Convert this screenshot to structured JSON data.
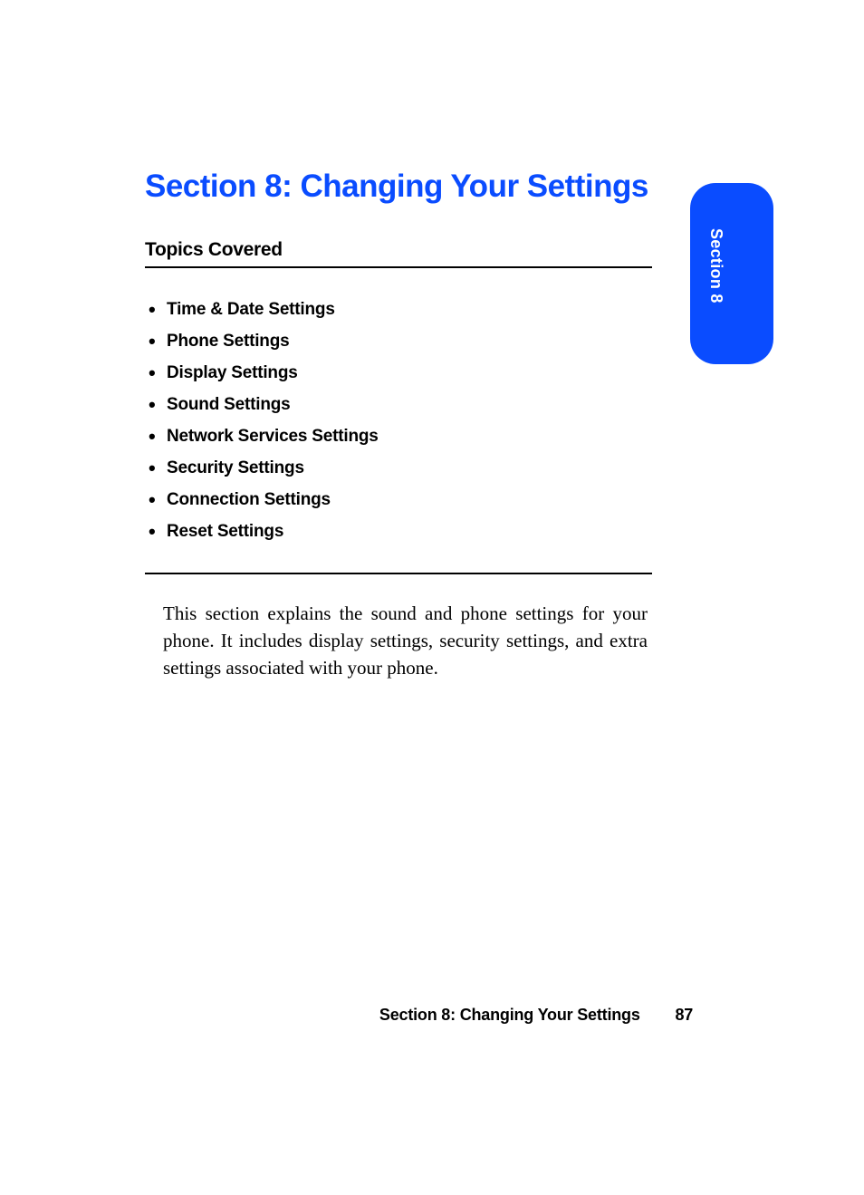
{
  "title": "Section 8: Changing Your Settings",
  "topics_heading": "Topics Covered",
  "topics": [
    "Time & Date Settings",
    "Phone Settings",
    "Display Settings",
    "Sound Settings",
    "Network Services Settings",
    "Security Settings",
    "Connection Settings",
    "Reset Settings"
  ],
  "body": "This section explains the sound and phone settings for your phone. It includes display settings, security settings, and extra settings associated with your phone.",
  "side_tab": "Section 8",
  "footer": {
    "title": "Section 8: Changing Your Settings",
    "page": "87"
  }
}
